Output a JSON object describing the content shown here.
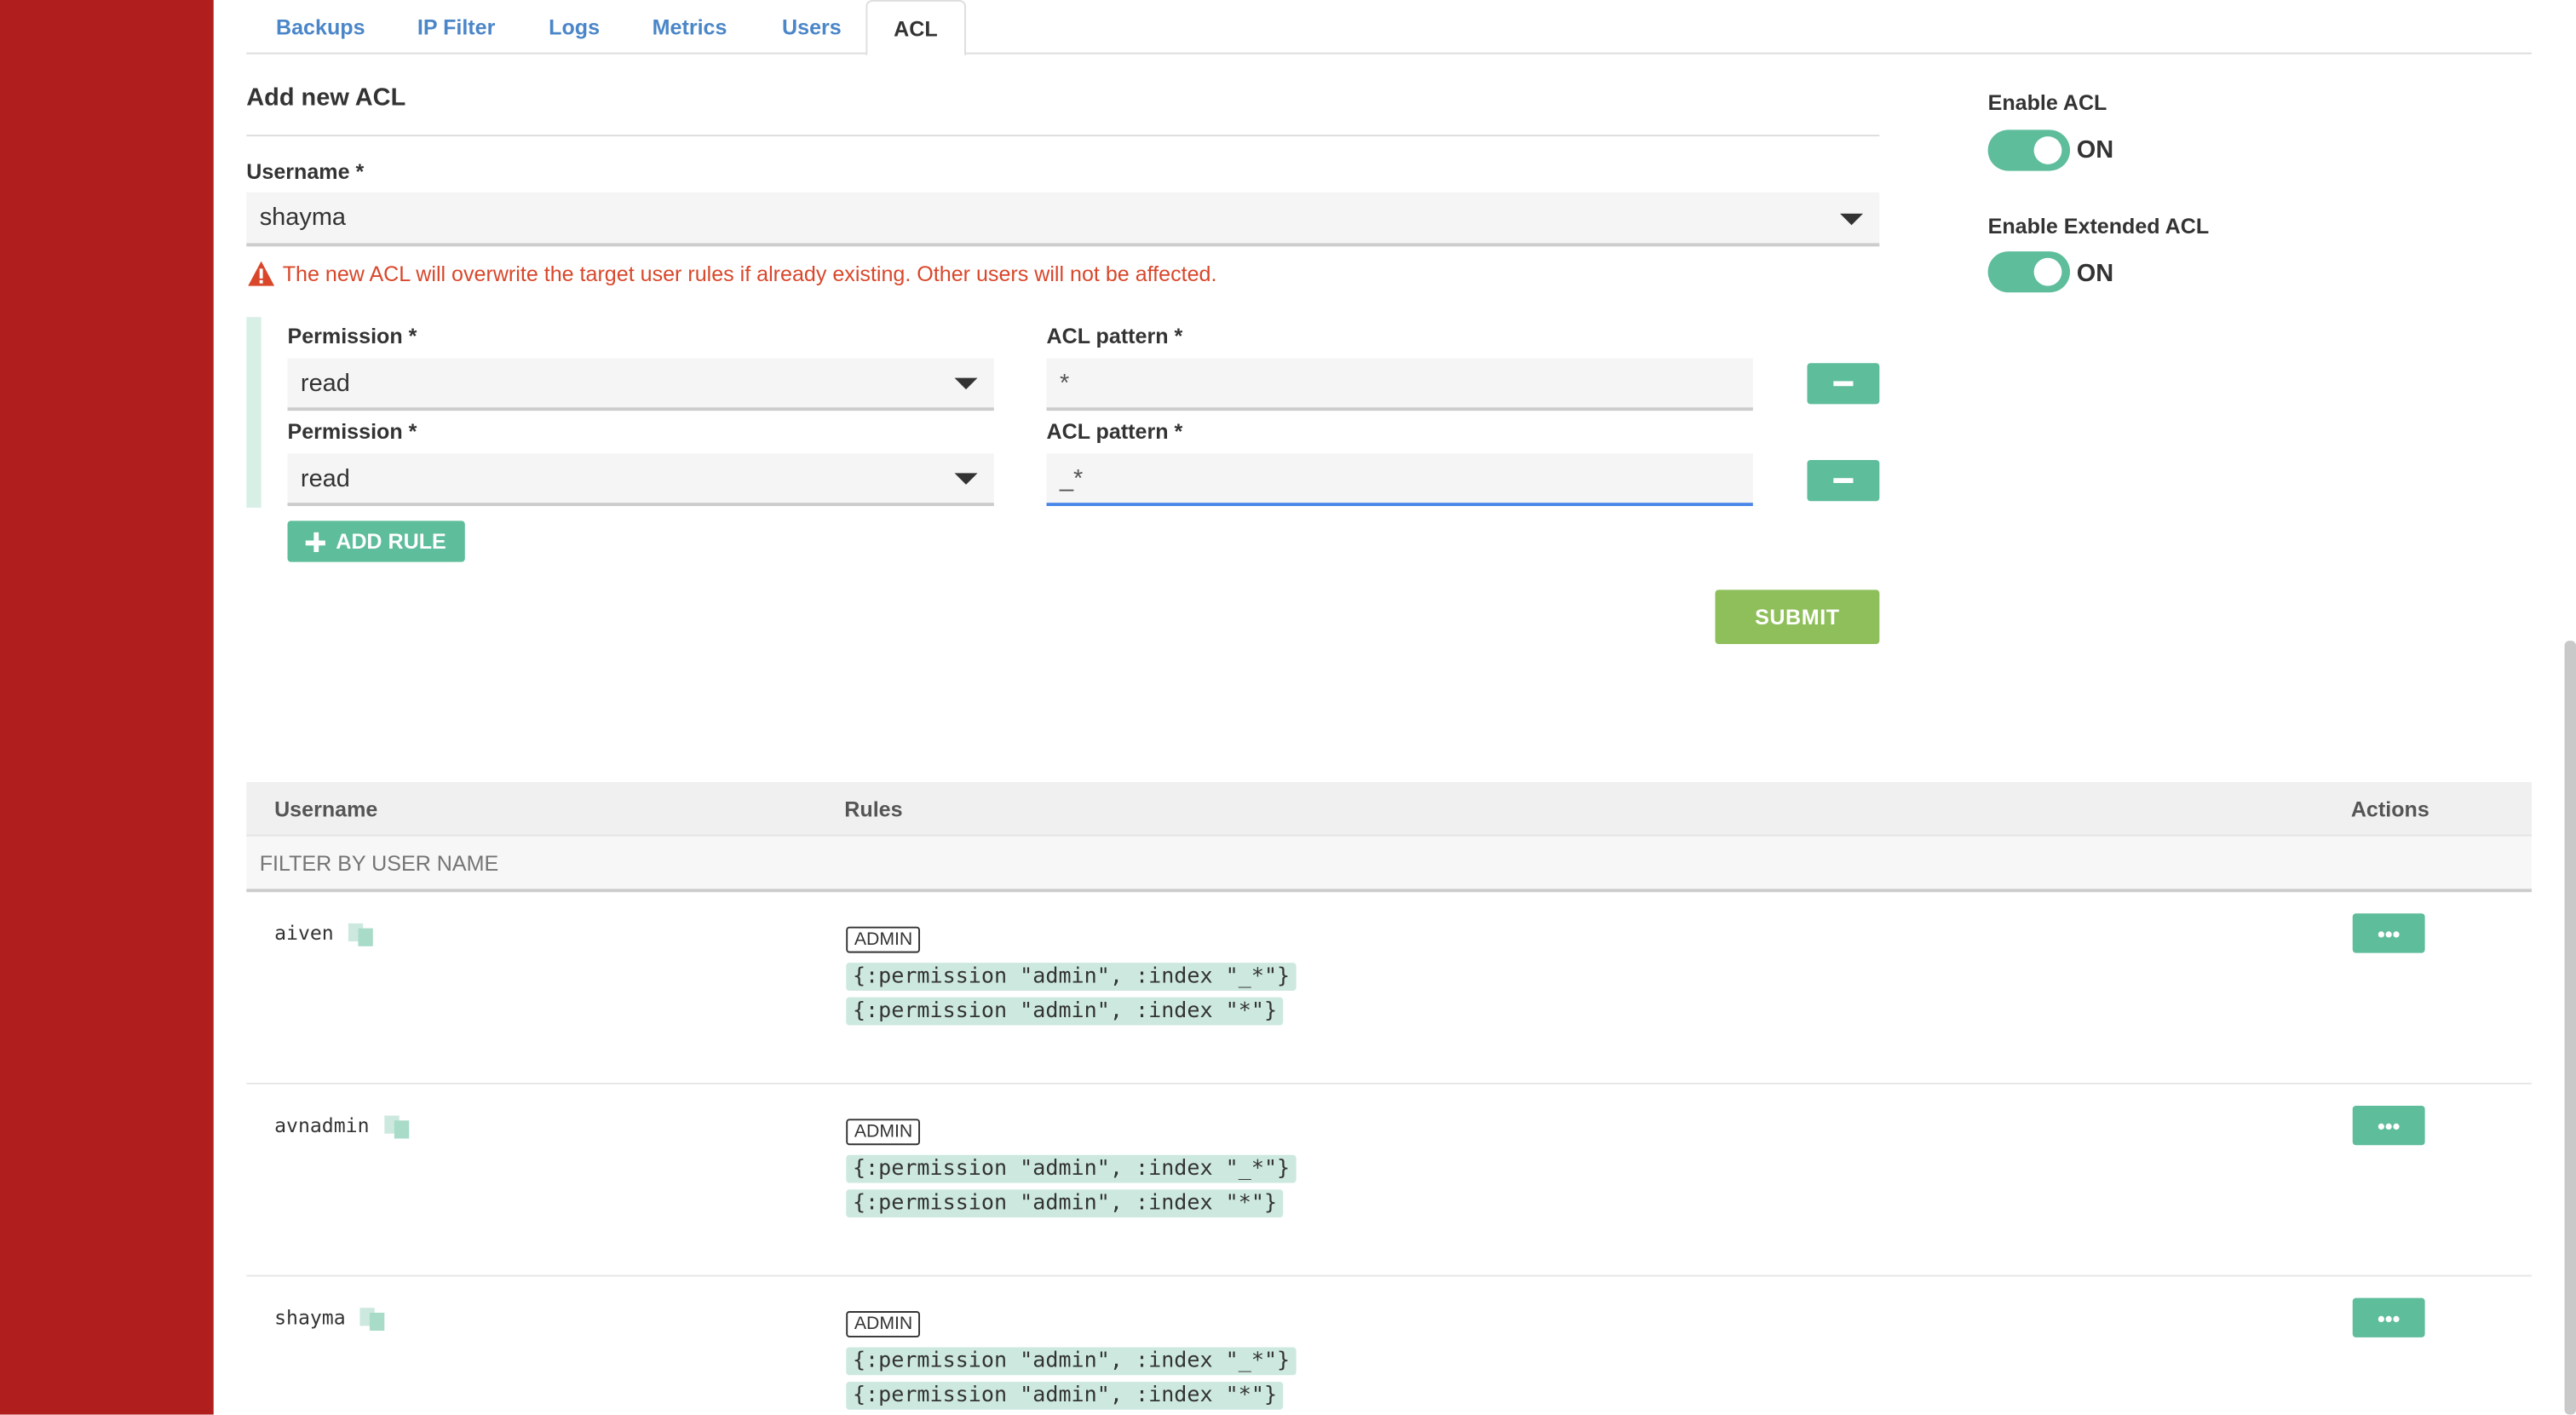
{
  "tabs": [
    "Backups",
    "IP Filter",
    "Logs",
    "Metrics",
    "Users",
    "ACL"
  ],
  "active_tab": "ACL",
  "form": {
    "title": "Add new ACL",
    "username_label": "Username *",
    "username_value": "shayma",
    "warning": "The new ACL will overwrite the target user rules if already existing. Other users will not be affected.",
    "rules": [
      {
        "permission_label": "Permission *",
        "permission_value": "read",
        "pattern_label": "ACL pattern *",
        "pattern_value": "*"
      },
      {
        "permission_label": "Permission *",
        "permission_value": "read",
        "pattern_label": "ACL pattern *",
        "pattern_value": "_*"
      }
    ],
    "add_rule_label": "ADD RULE",
    "submit_label": "SUBMIT"
  },
  "toggles": {
    "enable_acl_label": "Enable ACL",
    "enable_acl_state": "ON",
    "enable_extended_label": "Enable Extended ACL",
    "enable_extended_state": "ON"
  },
  "table": {
    "headers": [
      "Username",
      "Rules",
      "Actions"
    ],
    "filter_placeholder": "FILTER BY USER NAME",
    "rows": [
      {
        "username": "aiven",
        "badge": "ADMIN",
        "rules": [
          "{:permission \"admin\", :index \"_*\"}",
          "{:permission \"admin\", :index \"*\"}"
        ],
        "action": "•••"
      },
      {
        "username": "avnadmin",
        "badge": "ADMIN",
        "rules": [
          "{:permission \"admin\", :index \"_*\"}",
          "{:permission \"admin\", :index \"*\"}"
        ],
        "action": "•••"
      },
      {
        "username": "shayma",
        "badge": "ADMIN",
        "rules": [
          "{:permission \"admin\", :index \"_*\"}",
          "{:permission \"admin\", :index \"*\"}"
        ],
        "action": "•••"
      }
    ]
  },
  "colors": {
    "sidebar": "#b01e1e",
    "accent": "#5ebd9b",
    "submit": "#8fbf5a",
    "warning": "#d9472b",
    "link": "#4a86c8"
  }
}
